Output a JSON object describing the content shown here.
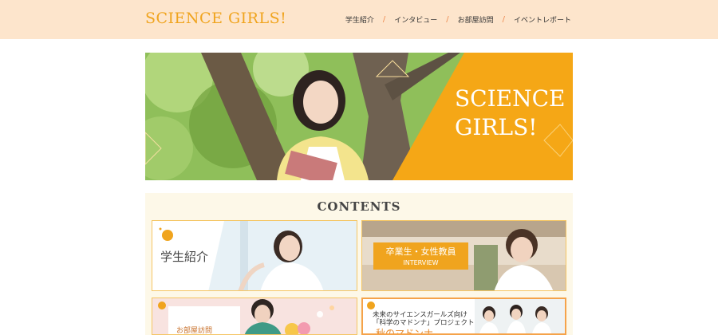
{
  "header": {
    "logo": "SCIENCE GIRLS!",
    "nav": [
      "学生紹介",
      "インタビュー",
      "お部屋訪問",
      "イベントレポート"
    ],
    "separator": "/"
  },
  "hero": {
    "line1": "SCIENCE",
    "line2": "GIRLS!"
  },
  "contents": {
    "title": "CONTENTS",
    "cards": [
      {
        "label": "学生紹介"
      },
      {
        "label_line1": "卒業生・女性教員",
        "label_line2": "INTERVIEW"
      },
      {
        "label": "お部屋訪問"
      },
      {
        "line1": "未来のサイエンスガールズ向け",
        "line2": "「科学のマドンナ」プロジェクト",
        "line3": "秋のマドンナ"
      }
    ]
  },
  "colors": {
    "accent": "#f0a41e",
    "header_bg": "#fde5cc",
    "contents_bg": "#fdf8e8",
    "separator": "#ee8a4f"
  }
}
